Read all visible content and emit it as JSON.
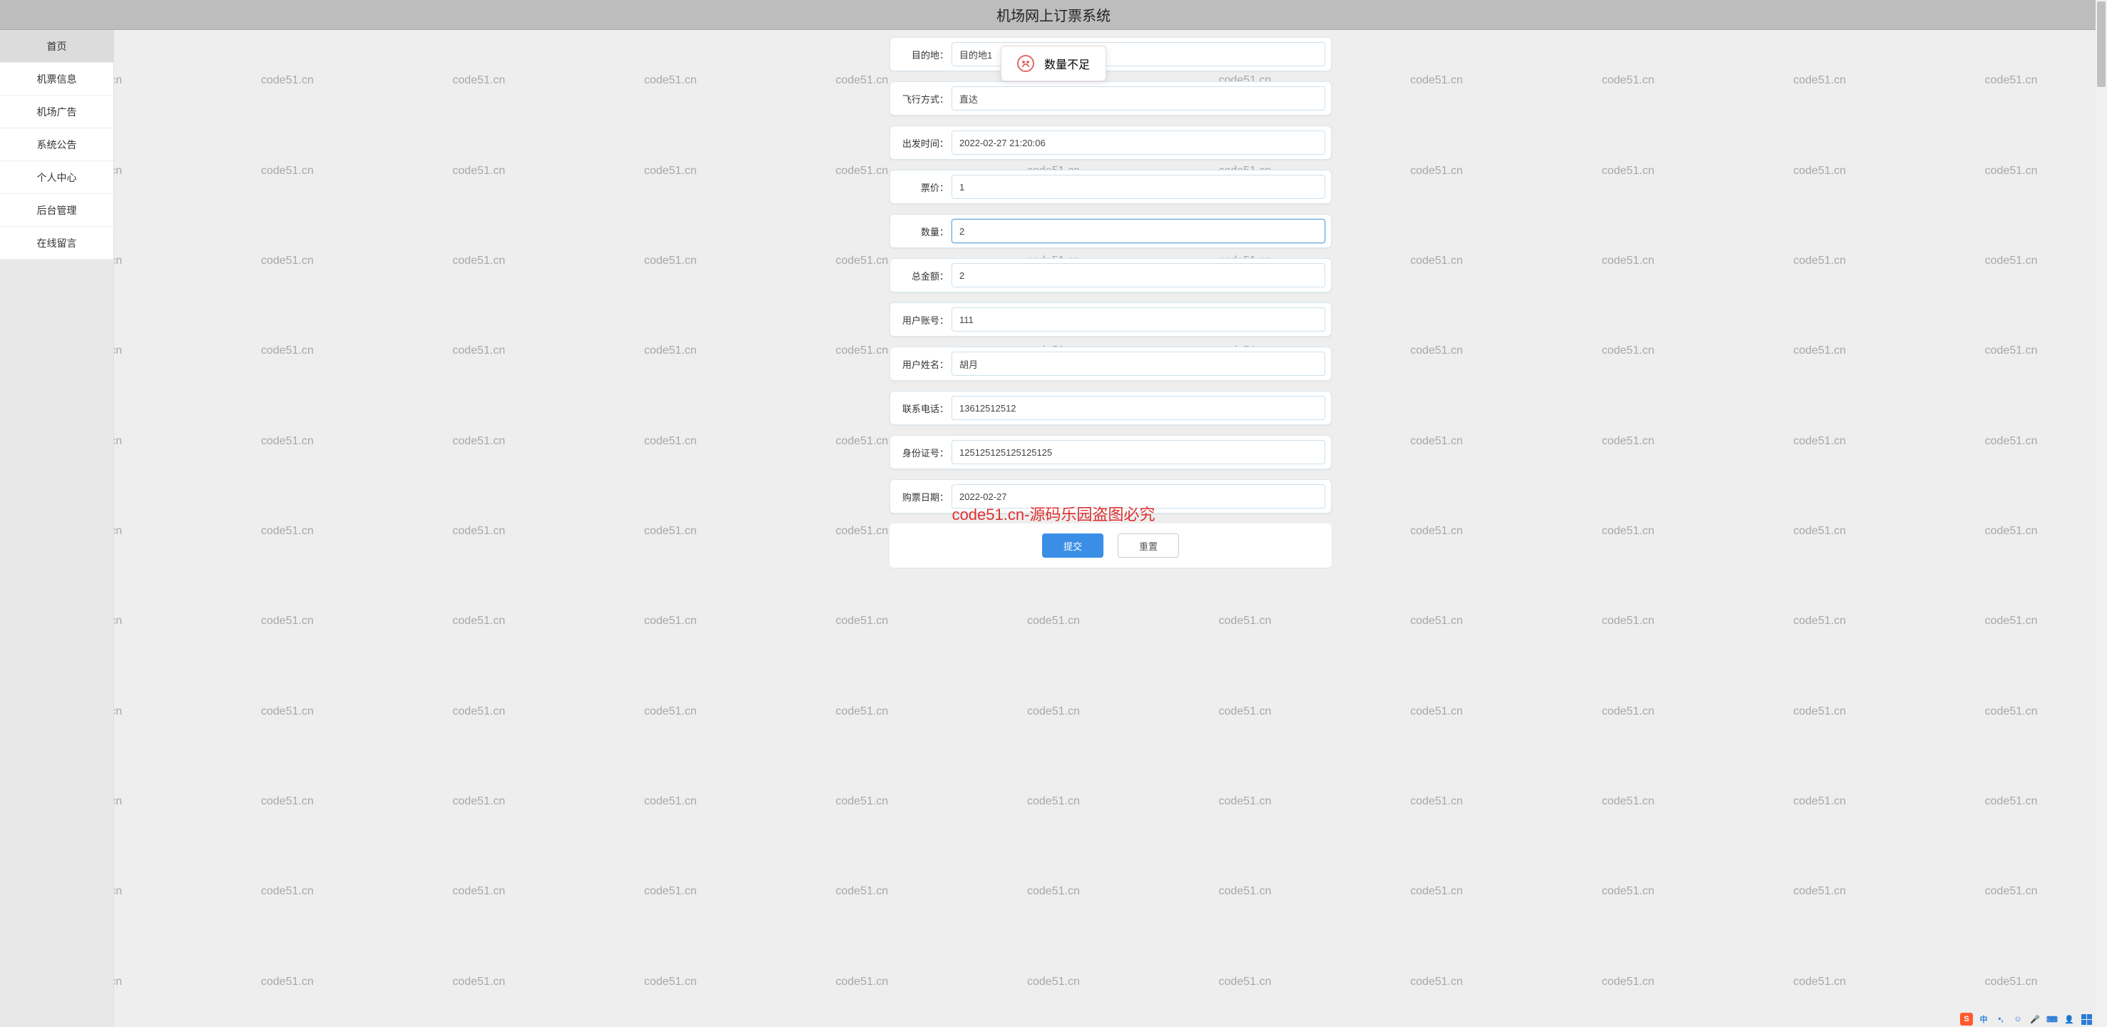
{
  "header": {
    "title": "机场网上订票系统"
  },
  "sidebar": {
    "items": [
      {
        "label": "首页",
        "active": true
      },
      {
        "label": "机票信息",
        "active": false
      },
      {
        "label": "机场广告",
        "active": false
      },
      {
        "label": "系统公告",
        "active": false
      },
      {
        "label": "个人中心",
        "active": false
      },
      {
        "label": "后台管理",
        "active": false
      },
      {
        "label": "在线留言",
        "active": false
      }
    ]
  },
  "form": {
    "fields": [
      {
        "label": "目的地：",
        "value": "目的地1"
      },
      {
        "label": "飞行方式：",
        "value": "直达"
      },
      {
        "label": "出发时间：",
        "value": "2022-02-27 21:20:06"
      },
      {
        "label": "票价：",
        "value": "1"
      },
      {
        "label": "数量：",
        "value": "2",
        "active": true
      },
      {
        "label": "总金额：",
        "value": "2"
      },
      {
        "label": "用户账号：",
        "value": "111"
      },
      {
        "label": "用户姓名：",
        "value": "胡月"
      },
      {
        "label": "联系电话：",
        "value": "13612512512"
      },
      {
        "label": "身份证号：",
        "value": "125125125125125125"
      },
      {
        "label": "购票日期：",
        "value": "2022-02-27"
      }
    ],
    "buttons": {
      "submit": "提交",
      "reset": "重置"
    }
  },
  "toast": {
    "message": "数量不足"
  },
  "watermark": {
    "text": "code51.cn",
    "center": "code51.cn-源码乐园盗图必究"
  },
  "ime": {
    "logo": "S",
    "lang": "中"
  }
}
